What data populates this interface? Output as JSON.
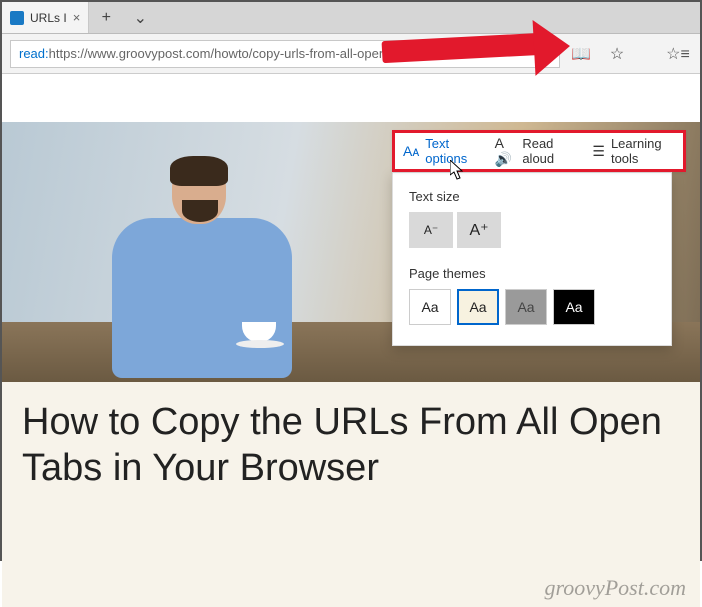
{
  "tab": {
    "title": "URLs I",
    "close": "×"
  },
  "tabstrip": {
    "plus": "+",
    "chevron": "⌄"
  },
  "address": {
    "protocol": "read:",
    "url_rest": "https://www.groovypost.com/howto/copy-urls-from-all-open-tabs-in-browser/"
  },
  "toolbar_icons": {
    "reading_view": "📖",
    "favorite": "☆",
    "favbar": "☆≡"
  },
  "reading_toolbar": {
    "text_options": {
      "label": "Text options",
      "icon": "Aᴀ"
    },
    "read_aloud": {
      "label": "Read aloud",
      "icon": "A🔊"
    },
    "learning": {
      "label": "Learning tools",
      "icon": "☰"
    }
  },
  "panel": {
    "text_size_label": "Text size",
    "size_small": "A⁻",
    "size_large": "A⁺",
    "page_themes_label": "Page themes",
    "theme_sample": "Aa"
  },
  "article": {
    "title": "How to Copy the URLs From All Open Tabs in Your Browser"
  },
  "watermark": "groovyPost.com"
}
